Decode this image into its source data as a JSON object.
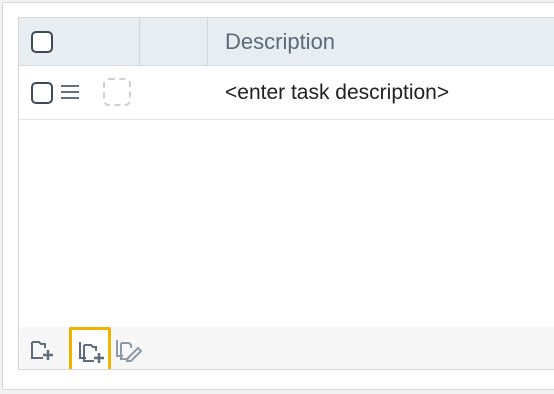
{
  "grid": {
    "header": {
      "description_label": "Description"
    },
    "rows": [
      {
        "description": "<enter task description>"
      }
    ]
  },
  "toolbar": {
    "icons": [
      "add-icon",
      "add-copy-icon",
      "edit-copy-icon"
    ],
    "selected_index": 1,
    "highlight_color": "#f0b400"
  },
  "colors": {
    "header_bg": "#e8edf2",
    "header_text": "#5c6a79",
    "checkbox_border": "#3b4b5b"
  }
}
